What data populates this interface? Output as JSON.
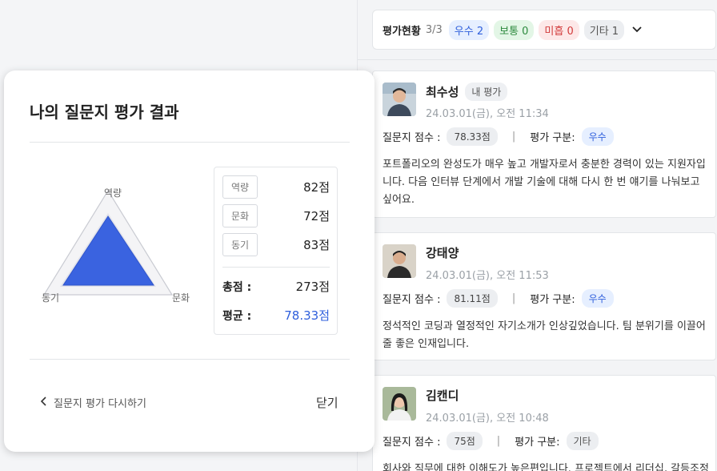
{
  "filter": {
    "title": "평가현황",
    "count": "3/3",
    "chips": [
      "우수 2",
      "보통 0",
      "미흡 0",
      "기타 1"
    ]
  },
  "cards": [
    {
      "name": "최수성",
      "badge": "내 평가",
      "date": "24.03.01(금), 오전 11:34",
      "score_label": "질문지 점수 :",
      "score": "78.33점",
      "sep": "|",
      "type_label": "평가 구분:",
      "type": "우수",
      "comment": "포트폴리오의 완성도가 매우 높고 개발자로서 충분한 경력이 있는 지원자입니다. 다음 인터뷰 단계에서 개발 기술에 대해 다시 한 번 얘기를 나눠보고 싶어요."
    },
    {
      "name": "강태양",
      "badge": "",
      "date": "24.03.01(금), 오전 11:53",
      "score_label": "질문지 점수 :",
      "score": "81.11점",
      "sep": "|",
      "type_label": "평가 구분:",
      "type": "우수",
      "comment": "정석적인 코딩과 열정적인 자기소개가 인상깊었습니다. 팀 분위기를 이끌어 줄 좋은 인재입니다."
    },
    {
      "name": "김캔디",
      "badge": "",
      "date": "24.03.01(금), 오전 10:48",
      "score_label": "질문지 점수 :",
      "score": "75점",
      "sep": "|",
      "type_label": "평가 구분:",
      "type": "기타",
      "comment": "회사와 직무에 대한 이해도가 높은편입니다. 프로젝트에서 리더십, 갈등조정"
    }
  ],
  "modal": {
    "title": "나의 질문지 평가 결과",
    "radar_labels": {
      "top": "역량",
      "left": "동기",
      "right": "문화"
    },
    "scores": [
      {
        "tag": "역량",
        "value": "82점"
      },
      {
        "tag": "문화",
        "value": "72점"
      },
      {
        "tag": "동기",
        "value": "83점"
      }
    ],
    "total_label": "총점 :",
    "total_value": "273점",
    "avg_label": "평균 :",
    "avg_value": "78.33점",
    "retry_label": "질문지 평가 다시하기",
    "close_label": "닫기"
  },
  "colors": {
    "accent": "#2f5fdc",
    "radar_fill": "#3a63e0"
  },
  "icons": {
    "chevron_down": "chevron-down-icon",
    "chevron_left": "chevron-left-icon"
  }
}
